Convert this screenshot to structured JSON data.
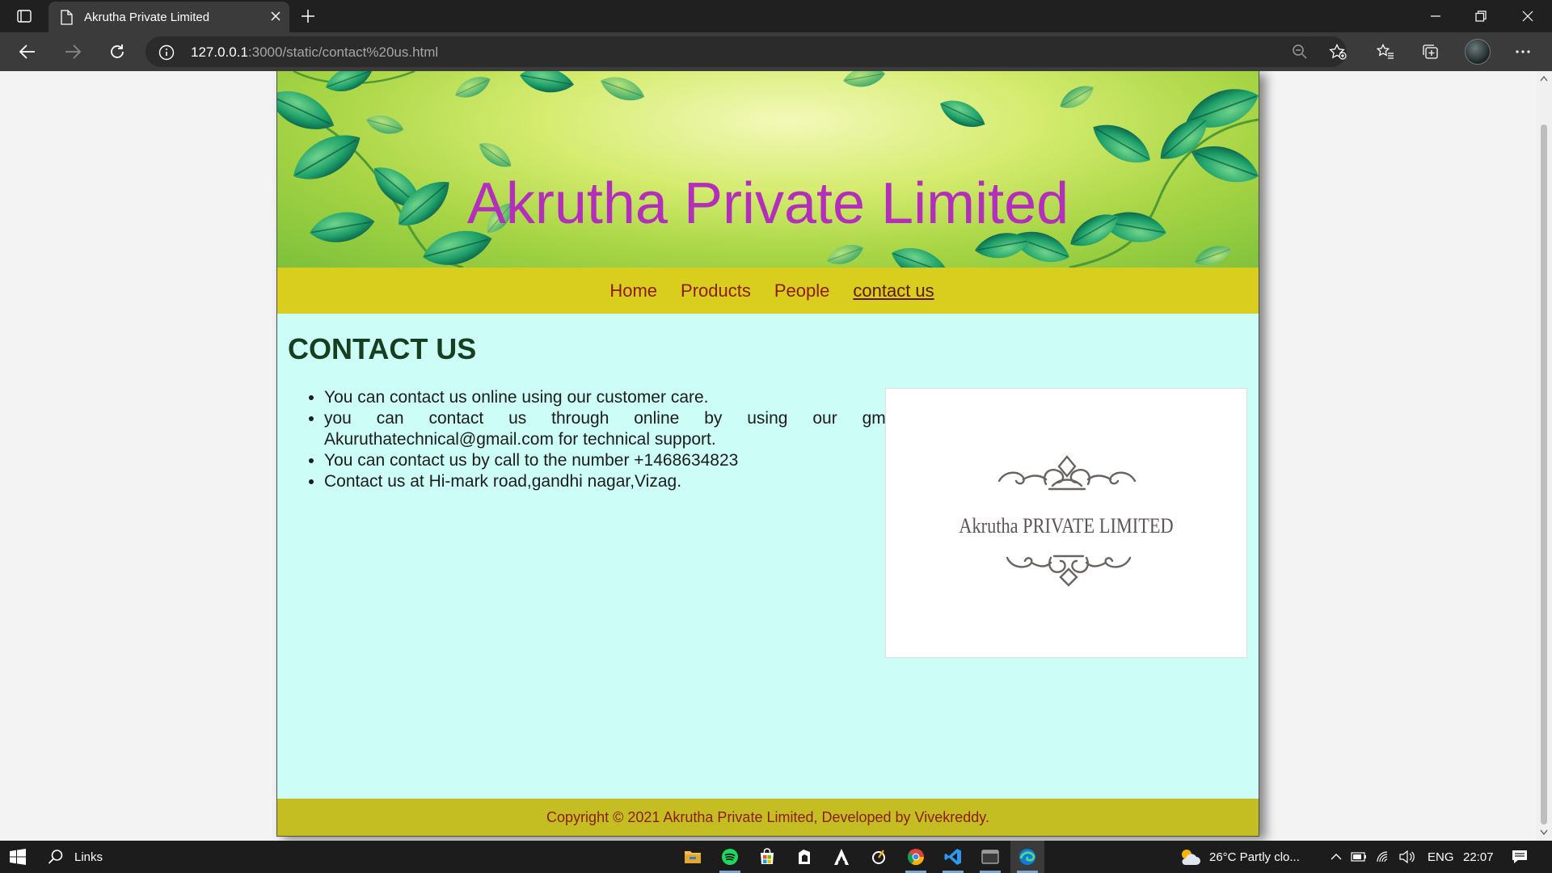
{
  "browser": {
    "tab_title": "Akrutha Private Limited",
    "url_host": "127.0.0.1",
    "url_rest": ":3000/static/contact%20us.html",
    "icons": [
      "tab-actions-icon",
      "page-icon",
      "close-icon",
      "plus-icon",
      "minimize-icon",
      "restore-icon",
      "close-icon",
      "back-icon",
      "forward-icon",
      "refresh-icon",
      "info-icon",
      "zoom-out-icon",
      "add-favorite-icon",
      "favorites-icon",
      "collections-icon",
      "profile-avatar",
      "more-icon"
    ]
  },
  "site": {
    "title": "Akrutha Private Limited",
    "nav": [
      {
        "label": "Home"
      },
      {
        "label": "Products"
      },
      {
        "label": "People"
      },
      {
        "label": "contact us",
        "active": true
      }
    ],
    "heading": "CONTACT US",
    "items": [
      "You can contact us online using our customer care.",
      "you can contact us through online by using our gmail id-Akuruthatechnical@gmail.com for technical support.",
      "You can contact us by call to the number +1468634823",
      "Contact us at Hi-mark road,gandhi nagar,Vizag."
    ],
    "logo_text": "Akrutha PRIVATE LIMITED",
    "footer": "Copyright © 2021 Akrutha Private Limited, Developed by Vivekreddy.",
    "colors": {
      "banner_title": "#b32fbb",
      "nav_bg": "#d9cd1d",
      "nav_link": "#8c1c1c",
      "content_bg": "#ccfdf6",
      "heading": "#163e20",
      "footer_bg": "#c5be22"
    }
  },
  "taskbar": {
    "search_label": "Links",
    "apps": [
      "file-explorer-icon",
      "spotify-icon",
      "store-icon",
      "app-icon",
      "assassins-creed-icon",
      "app-icon",
      "chrome-icon",
      "vscode-icon",
      "terminal-icon",
      "edge-icon"
    ],
    "weather": "26°C  Partly clo...",
    "language": "ENG",
    "time": "22:07"
  }
}
